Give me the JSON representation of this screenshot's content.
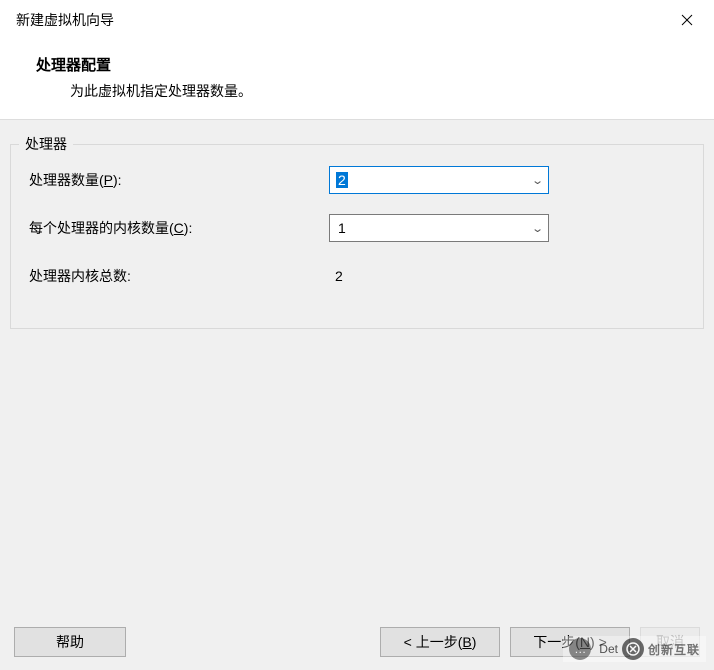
{
  "window": {
    "title": "新建虚拟机向导"
  },
  "header": {
    "heading": "处理器配置",
    "subheading": "为此虚拟机指定处理器数量。"
  },
  "group": {
    "title": "处理器"
  },
  "fields": {
    "proc_count": {
      "label_pre": "处理器数量(",
      "label_key": "P",
      "label_post": "):",
      "value": "2"
    },
    "cores_per_proc": {
      "label_pre": "每个处理器的内核数量(",
      "label_key": "C",
      "label_post": "):",
      "value": "1"
    },
    "total_cores": {
      "label": "处理器内核总数:",
      "value": "2"
    }
  },
  "buttons": {
    "help": "帮助",
    "back_pre": "< 上一步(",
    "back_key": "B",
    "back_post": ")",
    "next_pre": "下一步(",
    "next_key": "N",
    "next_post": ") >",
    "cancel": "取消"
  },
  "watermark": {
    "chat_label": "Det",
    "brand": "创新互联"
  }
}
